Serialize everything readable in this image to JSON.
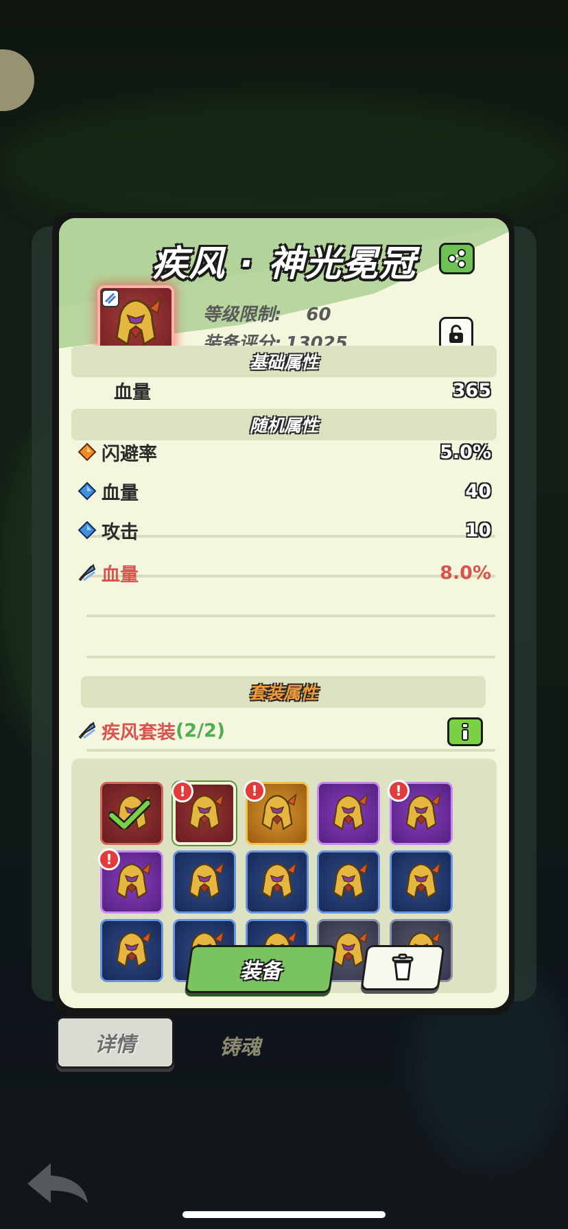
{
  "item": {
    "title": "疾风 · 神光冕冠",
    "level_label": "等级限制:",
    "level_value": "60",
    "score_label": "装备评分:",
    "score_value": "13025"
  },
  "sections": {
    "base": "基础属性",
    "random": "随机属性",
    "set": "套装属性"
  },
  "base_attrs": [
    {
      "label": "血量",
      "value": "365"
    }
  ],
  "random_attrs": [
    {
      "icon": "orange-diamond-icon",
      "label": "闪避率",
      "value": "5.0%"
    },
    {
      "icon": "blue-diamond-icon",
      "label": "血量",
      "value": "40"
    },
    {
      "icon": "blue-diamond-icon",
      "label": "攻击",
      "value": "10"
    },
    {
      "icon": "wind-set-icon",
      "label": "血量",
      "value": "8.0%",
      "color": "#d9534f"
    }
  ],
  "set": {
    "name": "疾风套装",
    "count": "(2/2)",
    "name_color": "#d9534f",
    "count_color": "#4caf50"
  },
  "inventory": [
    {
      "rarity": "red",
      "equipped": true,
      "alert": false
    },
    {
      "rarity": "redsel",
      "equipped": false,
      "alert": true
    },
    {
      "rarity": "gold",
      "equipped": false,
      "alert": true
    },
    {
      "rarity": "purple",
      "equipped": false,
      "alert": false
    },
    {
      "rarity": "purple",
      "equipped": false,
      "alert": true
    },
    {
      "rarity": "purple",
      "equipped": false,
      "alert": true
    },
    {
      "rarity": "blue",
      "equipped": false,
      "alert": false
    },
    {
      "rarity": "blue",
      "equipped": false,
      "alert": false
    },
    {
      "rarity": "blue",
      "equipped": false,
      "alert": false
    },
    {
      "rarity": "blue",
      "equipped": false,
      "alert": false
    },
    {
      "rarity": "blue",
      "equipped": false,
      "alert": false
    },
    {
      "rarity": "blue",
      "equipped": false,
      "alert": false
    },
    {
      "rarity": "blue",
      "equipped": false,
      "alert": false
    },
    {
      "rarity": "grey",
      "equipped": false,
      "alert": false
    },
    {
      "rarity": "grey",
      "equipped": false,
      "alert": false
    }
  ],
  "buttons": {
    "equip": "装备"
  },
  "tabs": {
    "detail": "详情",
    "forge": "铸魂"
  },
  "colors": {
    "card_bg": "#f4f7de",
    "accent_green": "#79c45e",
    "highlight_red": "#d9534f"
  }
}
